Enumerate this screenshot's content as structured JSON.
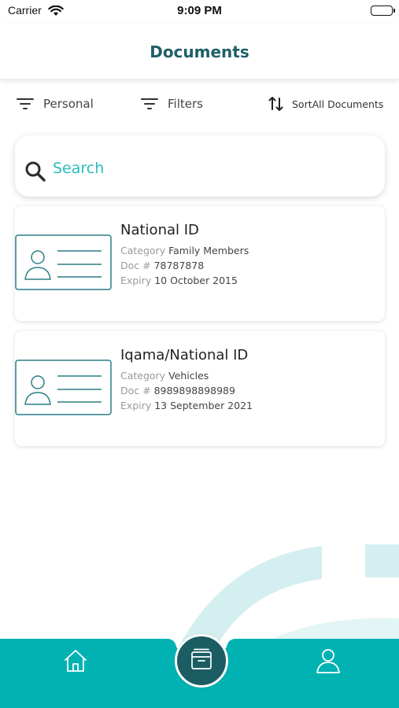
{
  "status_bar": {
    "carrier": "Carrier",
    "time": "9:09 PM"
  },
  "header": {
    "title": "Documents"
  },
  "filters": {
    "personal_label": "Personal",
    "filters_label": "Filters",
    "sort_label": "SortAll Documents"
  },
  "search": {
    "placeholder": "Search"
  },
  "documents": [
    {
      "title": "National ID",
      "category_key": "Category",
      "category_value": "Family Members",
      "doc_key": "Doc #",
      "doc_value": "78787878",
      "expiry_key": "Expiry",
      "expiry_value": "10 October 2015"
    },
    {
      "title": "Iqama/National ID",
      "category_key": "Category",
      "category_value": "Vehicles",
      "doc_key": "Doc #",
      "doc_value": "8989898898989",
      "expiry_key": "Expiry",
      "expiry_value": "13 September 2021"
    }
  ],
  "tab_bar": {
    "items": [
      {
        "icon": "home-icon"
      },
      {
        "icon": "archive-box-icon"
      },
      {
        "icon": "user-icon"
      }
    ],
    "active_index": 1
  },
  "colors": {
    "primary_dark": "#1e5f67",
    "accent_teal": "#00b2b2",
    "search_text": "#2bbcbc",
    "decor_light": "#d4eff0"
  }
}
